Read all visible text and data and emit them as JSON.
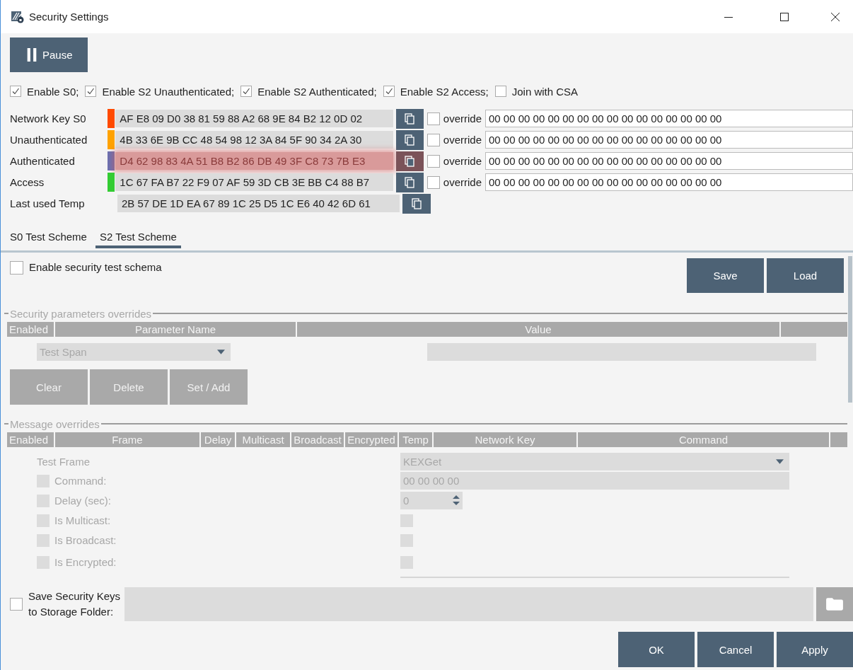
{
  "window": {
    "title": "Security Settings"
  },
  "pause_button": "Pause",
  "security_classes": [
    {
      "label": "Enable S0;",
      "checked": true
    },
    {
      "label": "Enable S2 Unauthenticated;",
      "checked": true
    },
    {
      "label": "Enable S2 Authenticated;",
      "checked": true
    },
    {
      "label": "Enable S2 Access;",
      "checked": true
    },
    {
      "label": "Join with CSA",
      "checked": false
    }
  ],
  "keys": [
    {
      "label": "Network Key S0",
      "color": "#ff4a00",
      "value": "AF E8 09 D0 38 81 59 88 A2 68 9E 84 B2 12 0D 02",
      "highlighted": false,
      "override": {
        "label": "override",
        "checked": false,
        "value": "00 00 00 00 00 00 00 00 00 00 00 00 00 00 00 00"
      }
    },
    {
      "label": "Unauthenticated",
      "color": "#ffa200",
      "value": "4B 33 6E 9B CC 48 54 98 12 3A 84 5F 90 34 2A 30",
      "highlighted": false,
      "override": {
        "label": "override",
        "checked": false,
        "value": "00 00 00 00 00 00 00 00 00 00 00 00 00 00 00 00"
      }
    },
    {
      "label": "Authenticated",
      "color": "#6b70b0",
      "value": "D4 62 98 83 4A 51 B8 B2 86 DB 49 3F C8 73 7B E3",
      "highlighted": true,
      "override": {
        "label": "override",
        "checked": false,
        "value": "00 00 00 00 00 00 00 00 00 00 00 00 00 00 00 00"
      }
    },
    {
      "label": "Access",
      "color": "#33cc33",
      "value": "1C 67 FA B7 22 F9 07 AF 59 3D CB 3E BB C4 88 B7",
      "highlighted": false,
      "override": {
        "label": "override",
        "checked": false,
        "value": "00 00 00 00 00 00 00 00 00 00 00 00 00 00 00 00"
      }
    },
    {
      "label": "Last used Temp",
      "value": "2B 57 DE 1D EA 67 89 1C 25 D5 1C E6 40 42 6D 61",
      "highlighted": false
    }
  ],
  "tabs": [
    {
      "label": "S0 Test Scheme",
      "selected": false
    },
    {
      "label": "S2 Test Scheme",
      "selected": true
    }
  ],
  "test_scheme": {
    "disabled": true,
    "enable": {
      "label": "Enable security test schema",
      "checked": false
    },
    "buttons": [
      "Save",
      "Load"
    ],
    "parameters": {
      "title": "Security parameters overrides",
      "columns": [
        "Enabled",
        "Parameter Name",
        "Value"
      ],
      "parameter": "Test Span",
      "buttons": [
        "Clear",
        "Delete",
        "Set / Add"
      ]
    },
    "messages": {
      "title": "Message overrides",
      "columns": [
        "Enabled",
        "Frame",
        "Delay",
        "Multicast",
        "Broadcast",
        "Encrypted",
        "Temp",
        "Network Key",
        "Command"
      ],
      "frame": "Test Frame",
      "network_key": "KEXGet",
      "fields": [
        {
          "kind": "text",
          "label": "Command:",
          "enabled": false,
          "value": "00 00 00 00"
        },
        {
          "kind": "spin",
          "label": "Delay (sec):",
          "enabled": false,
          "value": "0"
        },
        {
          "kind": "check",
          "label": "Is Multicast:",
          "enabled": false,
          "checked": false
        },
        {
          "kind": "check",
          "label": "Is Broadcast:",
          "enabled": false,
          "checked": false
        },
        {
          "kind": "check",
          "label": "Is Encrypted:",
          "enabled": false,
          "checked": false
        }
      ]
    }
  },
  "save_keys": {
    "label": "Save Security Keys to Storage Folder:",
    "checked": false
  },
  "buttons": [
    "OK",
    "Cancel",
    "Apply"
  ]
}
